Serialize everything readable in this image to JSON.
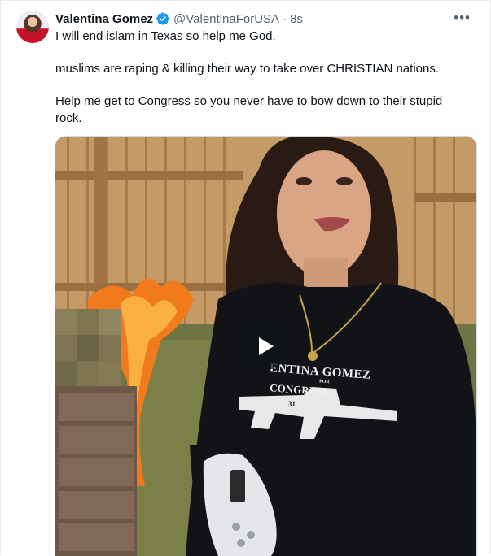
{
  "tweet": {
    "display_name": "Valentina Gomez",
    "handle": "@ValentinaForUSA",
    "separator": "·",
    "time": "8s",
    "more_icon": "more-horizontal-icon",
    "verified_icon": "verified-badge-icon",
    "paragraphs": [
      "I will end islam in Texas so help me God.",
      "muslims are raping & killing their way to take over CHRISTIAN nations.",
      "Help me get to Congress so you never have to bow down to their stupid rock."
    ]
  },
  "media": {
    "shirt_text_line1": "ENTINA GOMEZ",
    "shirt_text_small": "FOR",
    "shirt_text_line2": "CONGRESS",
    "shirt_number": "31",
    "play_icon": "play-icon"
  },
  "colors": {
    "verified": "#1d9bf0",
    "text": "#0f1419",
    "muted": "#536471",
    "border": "#e6e9ec"
  }
}
